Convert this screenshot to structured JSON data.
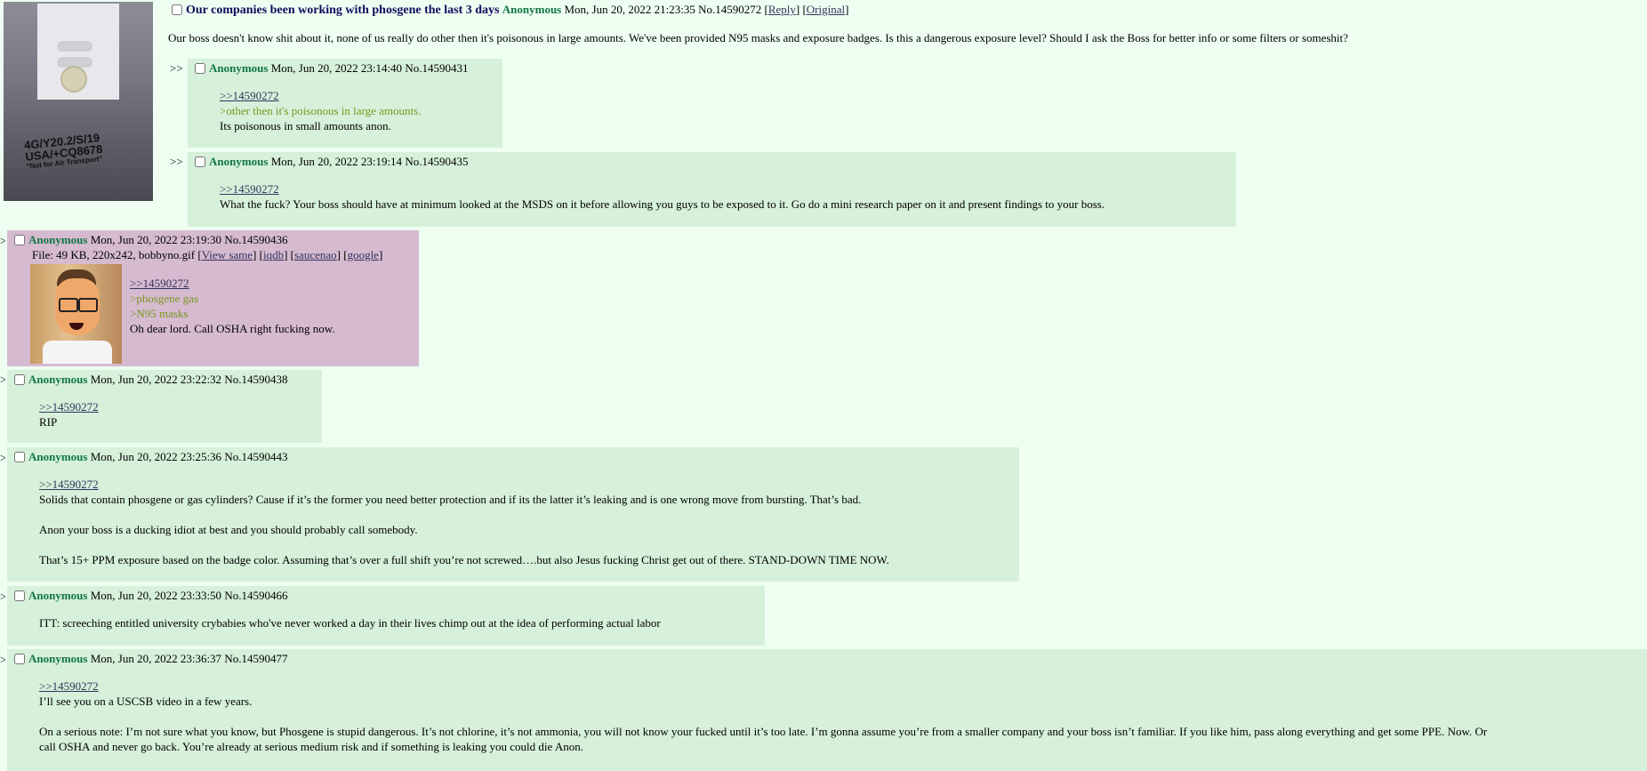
{
  "op": {
    "subject": "Our companies been working with phosgene the last 3 days",
    "name": "Anonymous",
    "datetime": "Mon, Jun 20, 2022 21:23:35",
    "number": "No.14590272",
    "reply_link": "Reply",
    "original_link": "Original",
    "text": "Our boss doesn't know shit about it, none of us really do other then it's poisonous in large amounts. We've been provided N95 masks and exposure badges. Is this a dangerous exposure level? Should I ask the Boss for better info or some filters or someshit?",
    "image_text": {
      "line1": "4G/Y20.2/S/19",
      "line2": "USA/+CQ8678",
      "line3": "\"Not for Air Transport\""
    }
  },
  "arrow": ">>",
  "side_arrow": ">",
  "replies": [
    {
      "name": "Anonymous",
      "datetime": "Mon, Jun 20, 2022 23:14:40",
      "number": "No.14590431",
      "backlink": ">>14590272",
      "quote1": ">other then it's poisonous in large amounts.",
      "line1": "Its poisonous in small amounts anon."
    },
    {
      "name": "Anonymous",
      "datetime": "Mon, Jun 20, 2022 23:19:14",
      "number": "No.14590435",
      "backlink": ">>14590272",
      "line1": "What the fuck? Your boss should have at minimum looked at the MSDS on it before allowing you guys to be exposed to it. Go do a mini research paper on it and present findings to your boss."
    },
    {
      "name": "Anonymous",
      "datetime": "Mon, Jun 20, 2022 23:19:30",
      "number": "No.14590436",
      "file_prefix": "File: 49 KB, 220x242, bobbyno.gif",
      "view_same": "View same",
      "iqdb": "iqdb",
      "saucenao": "saucenao",
      "google": "google",
      "backlink": ">>14590272",
      "quote1": ">phosgene gas",
      "quote2": ">N95 masks",
      "line1": "Oh dear lord. Call OSHA right fucking now."
    },
    {
      "name": "Anonymous",
      "datetime": "Mon, Jun 20, 2022 23:22:32",
      "number": "No.14590438",
      "backlink": ">>14590272",
      "line1": "RIP"
    },
    {
      "name": "Anonymous",
      "datetime": "Mon, Jun 20, 2022 23:25:36",
      "number": "No.14590443",
      "backlink": ">>14590272",
      "line1": "Solids that contain phosgene or gas cylinders? Cause if it’s the former you need better protection and if its the latter it’s leaking and is one wrong move from bursting. That’s bad.",
      "line2": "Anon your boss is a ducking idiot at best and you should probably call somebody.",
      "line3": "That’s 15+ PPM exposure based on the badge color. Assuming that’s over a full shift you’re not screwed….but also Jesus fucking Christ get out of there. STAND-DOWN TIME NOW."
    },
    {
      "name": "Anonymous",
      "datetime": "Mon, Jun 20, 2022 23:33:50",
      "number": "No.14590466",
      "line1": "ITT: screeching entitled university crybabies who've never worked a day in their lives chimp out at the idea of performing actual labor"
    },
    {
      "name": "Anonymous",
      "datetime": "Mon, Jun 20, 2022 23:36:37",
      "number": "No.14590477",
      "backlink": ">>14590272",
      "line1": "I’ll see you on a USCSB video in a few years.",
      "line2": "On a serious note: I’m not sure what you know, but Phosgene is stupid dangerous. It’s not chlorine, it’s not ammonia, you will not know your fucked until it’s too late. I’m gonna assume you’re from a smaller company and your boss isn’t familiar. If you like him, pass along everything and get some PPE. Now. Or",
      "line3": "call OSHA and never go back. You’re already at serious medium risk and if something is leaking you could die Anon."
    }
  ],
  "colors": {
    "background": "#eefff2",
    "reply_bg": "#d6f0da",
    "highlight_bg": "#d6bad0",
    "name": "#117743",
    "quote": "#789922",
    "subject": "#0f0c5d",
    "link": "#34345c"
  }
}
